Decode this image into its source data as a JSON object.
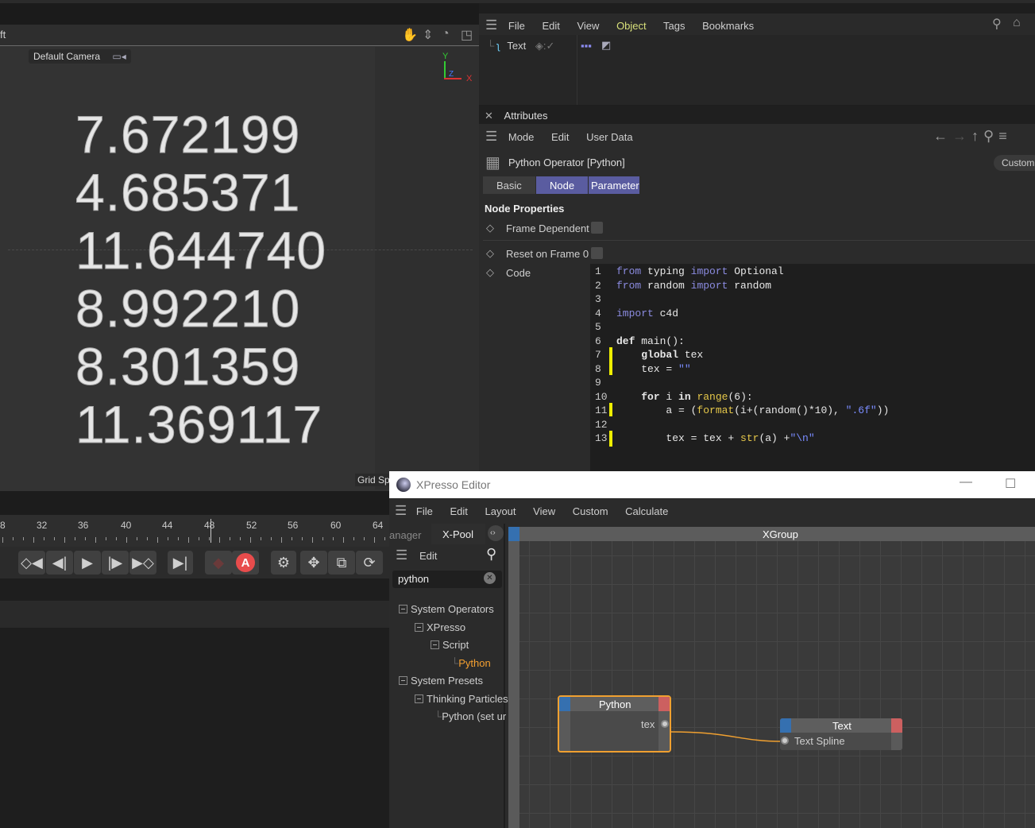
{
  "viewport": {
    "label_partial": "ft",
    "camera": "Default Camera",
    "grid_label": "Grid Sp",
    "axes": {
      "y": "Y",
      "x": "X",
      "z": "Z"
    },
    "numbers": [
      "7.672199",
      "4.685371",
      "11.644740",
      "8.992210",
      "8.301359",
      "11.369117"
    ]
  },
  "timeline": {
    "ticks": [
      "8",
      "32",
      "36",
      "40",
      "44",
      "48",
      "52",
      "56",
      "60",
      "64"
    ],
    "current_frame": "48"
  },
  "object_manager": {
    "menu": [
      "File",
      "Edit",
      "View",
      "Object",
      "Tags",
      "Bookmarks"
    ],
    "object_name": "Text"
  },
  "attributes": {
    "title": "Attributes",
    "menu": [
      "Mode",
      "Edit",
      "User Data"
    ],
    "object_title": "Python Operator [Python]",
    "custom_button": "Custom",
    "tabs": [
      "Basic",
      "Node",
      "Parameter"
    ],
    "section": "Node Properties",
    "props": [
      "Frame Dependent",
      "Reset on Frame 0",
      "Code"
    ],
    "frame_dependent": false,
    "reset_on_frame0": false
  },
  "code_lines": [
    "from typing import Optional",
    "from random import random",
    "",
    "import c4d",
    "",
    "def main():",
    "    global tex",
    "    tex = \"\"",
    "",
    "    for i in range(6):",
    "        a = (format(i+(random()*10), \".6f\"))",
    "",
    "        tex = tex + str(a) +\"\\n\""
  ],
  "xpresso": {
    "title": "XPresso Editor",
    "menu": [
      "File",
      "Edit",
      "Layout",
      "View",
      "Custom",
      "Calculate"
    ],
    "tabs": [
      "anager",
      "X-Pool"
    ],
    "pool_menu": "Edit",
    "search_value": "python",
    "tree": [
      "System Operators",
      "XPresso",
      "Script",
      "Python",
      "System Presets",
      "Thinking Particles",
      "Python (set ur"
    ],
    "group_title": "XGroup",
    "nodes": [
      {
        "title": "Python",
        "port": "tex"
      },
      {
        "title": "Text",
        "port": "Text Spline"
      }
    ],
    "accent": "#f0a030"
  }
}
